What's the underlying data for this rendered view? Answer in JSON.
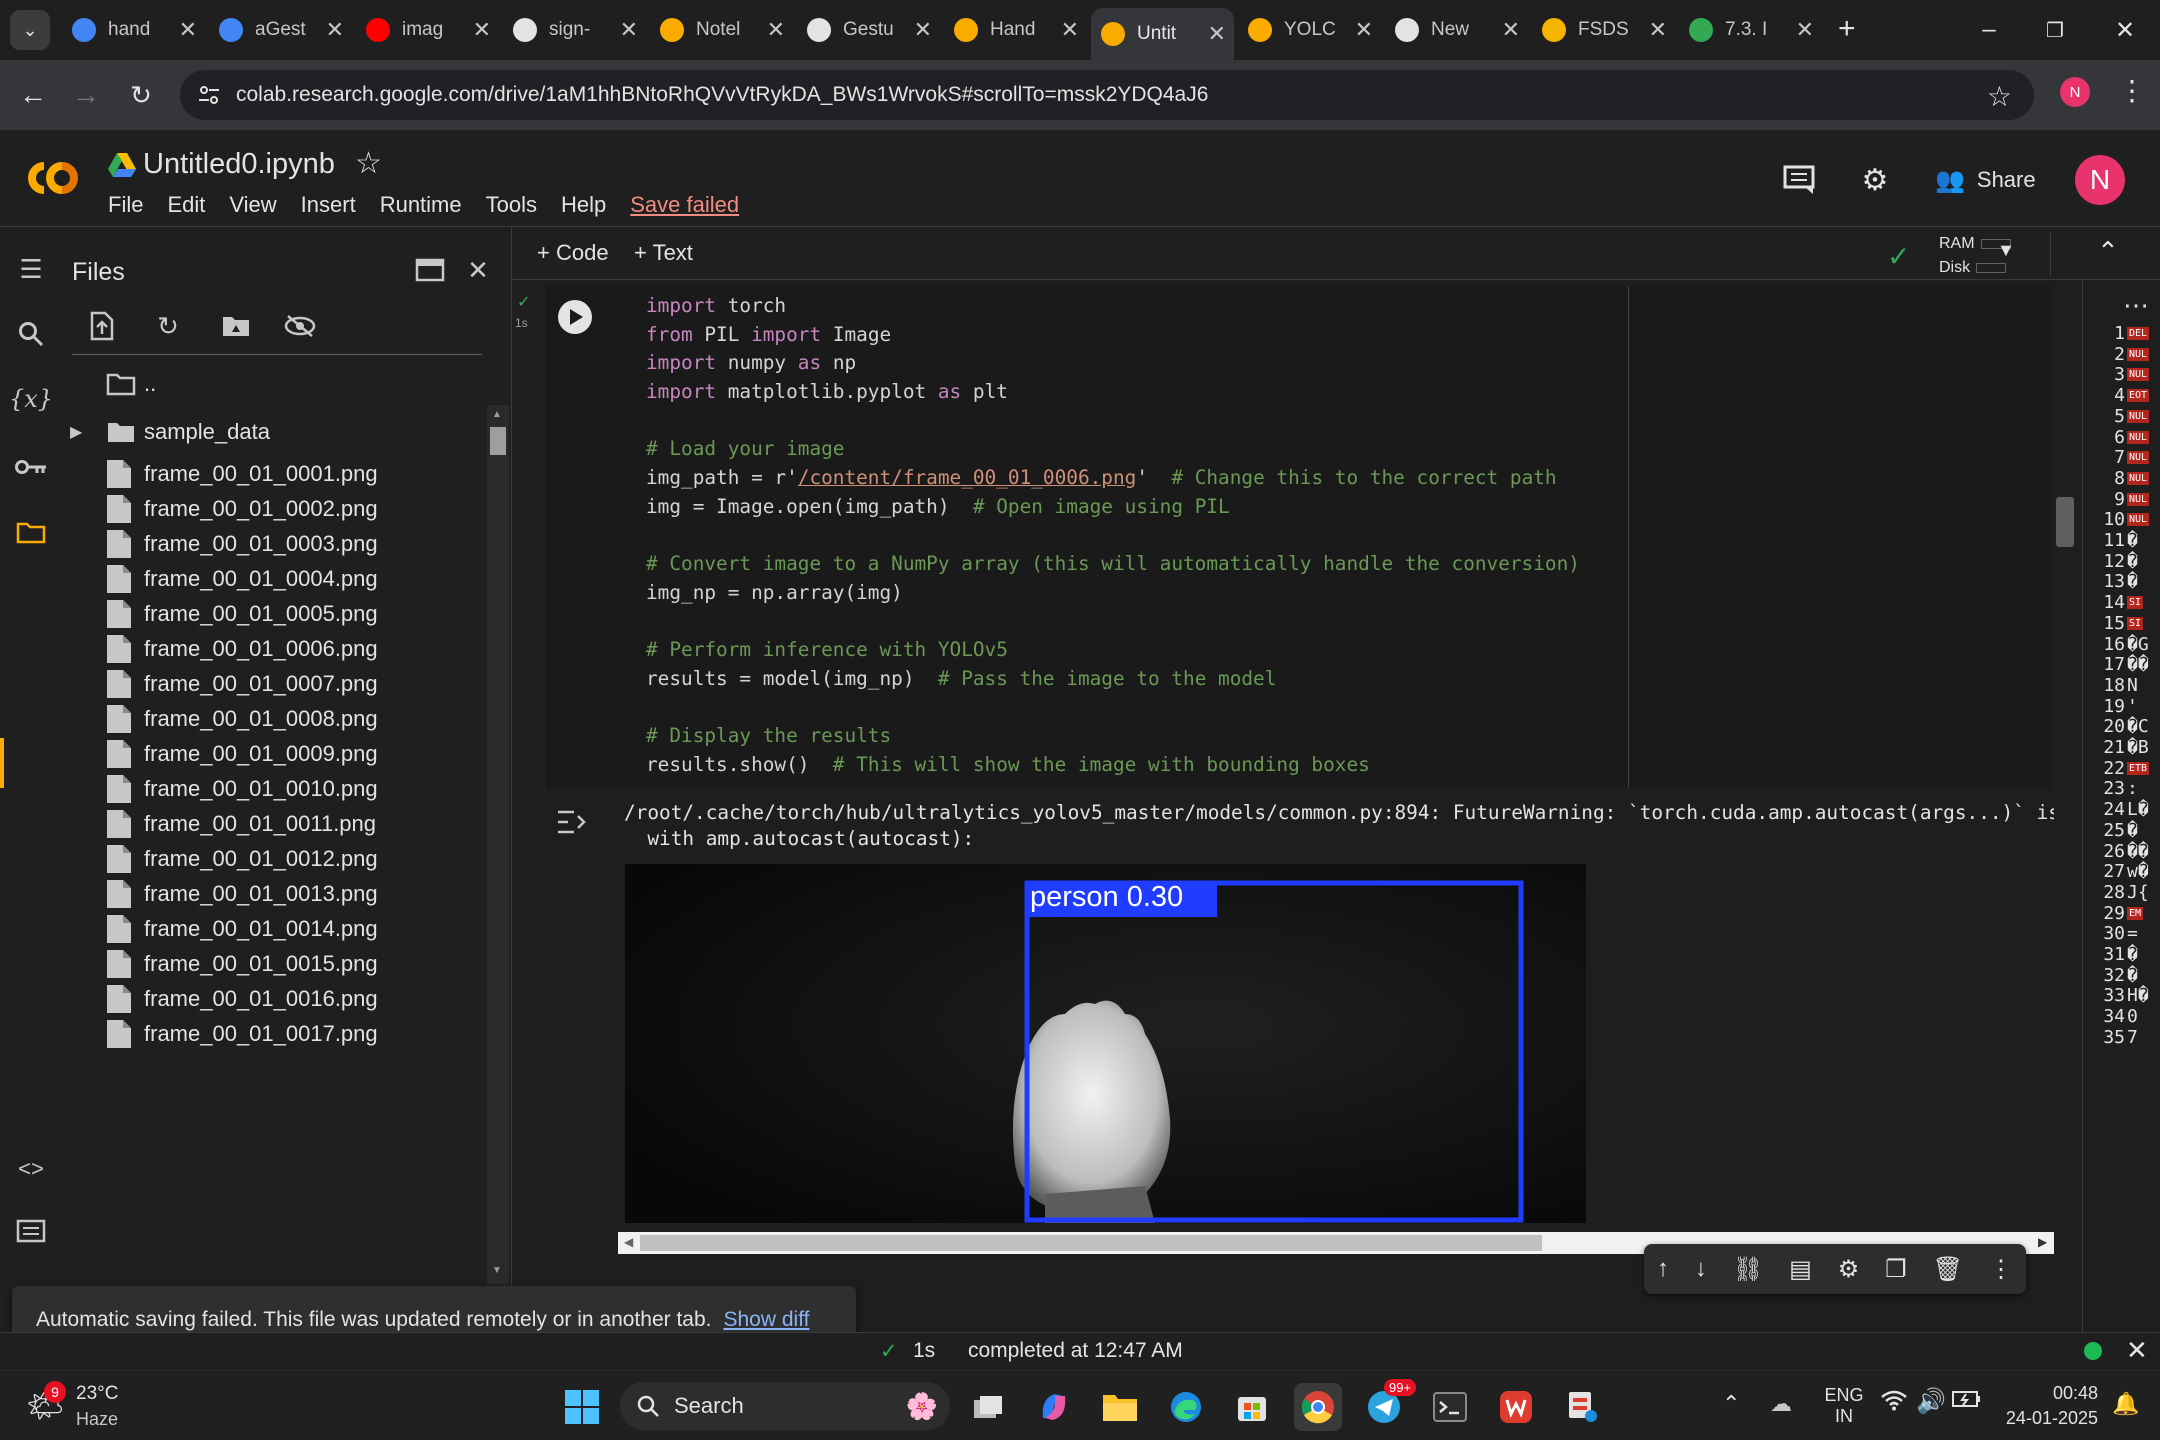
{
  "tabs": [
    {
      "label": "hand",
      "icon": "google-icon",
      "color": "#4285f4"
    },
    {
      "label": "aGest",
      "icon": "google-icon",
      "color": "#4285f4"
    },
    {
      "label": "imag",
      "icon": "youtube-icon",
      "color": "#ff0000"
    },
    {
      "label": "sign-",
      "icon": "github-icon",
      "color": "#e3e3e3"
    },
    {
      "label": "Notel",
      "icon": "colab-icon",
      "color": "#f9ab00"
    },
    {
      "label": "Gestu",
      "icon": "github-icon",
      "color": "#e3e3e3"
    },
    {
      "label": "Hand",
      "icon": "colab-icon",
      "color": "#f9ab00"
    },
    {
      "label": "Untit",
      "icon": "colab-icon",
      "color": "#f9ab00",
      "active": true
    },
    {
      "label": "YOLC",
      "icon": "colab-icon",
      "color": "#f9ab00"
    },
    {
      "label": "New",
      "icon": "chrome-icon",
      "color": "#e3e3e3"
    },
    {
      "label": "FSDS",
      "icon": "sheets-icon",
      "color": "#f4b400"
    },
    {
      "label": "7.3. I",
      "icon": "drive-icon",
      "color": "#34a853"
    }
  ],
  "address": {
    "url": "colab.research.google.com/drive/1aM1hhBNtoRhQVvVtRykDA_BWs1WrvokS#scrollTo=mssk2YDQ4aJ6",
    "profile_initial": "N"
  },
  "colab": {
    "title": "Untitled0.ipynb",
    "menu": [
      "File",
      "Edit",
      "View",
      "Insert",
      "Runtime",
      "Tools",
      "Help"
    ],
    "save_status": "Save failed",
    "share_label": "Share",
    "avatar_initial": "N"
  },
  "files_panel": {
    "title": "Files",
    "parent_dir": "..",
    "folder": "sample_data",
    "files": [
      "frame_00_01_0001.png",
      "frame_00_01_0002.png",
      "frame_00_01_0003.png",
      "frame_00_01_0004.png",
      "frame_00_01_0005.png",
      "frame_00_01_0006.png",
      "frame_00_01_0007.png",
      "frame_00_01_0008.png",
      "frame_00_01_0009.png",
      "frame_00_01_0010.png",
      "frame_00_01_0011.png",
      "frame_00_01_0012.png",
      "frame_00_01_0013.png",
      "frame_00_01_0014.png",
      "frame_00_01_0015.png",
      "frame_00_01_0016.png",
      "frame_00_01_0017.png"
    ]
  },
  "notebook_toolbar": {
    "add_code": "+ Code",
    "add_text": "+ Text",
    "ram_label": "RAM",
    "disk_label": "Disk"
  },
  "cell": {
    "exec_time": "1s",
    "code_lines": [
      [
        {
          "t": "import",
          "c": "kw"
        },
        {
          "t": " torch"
        }
      ],
      [
        {
          "t": "from",
          "c": "kw"
        },
        {
          "t": " PIL "
        },
        {
          "t": "import",
          "c": "kw"
        },
        {
          "t": " Image"
        }
      ],
      [
        {
          "t": "import",
          "c": "kw"
        },
        {
          "t": " numpy "
        },
        {
          "t": "as",
          "c": "kw"
        },
        {
          "t": " np"
        }
      ],
      [
        {
          "t": "import",
          "c": "kw"
        },
        {
          "t": " matplotlib.pyplot "
        },
        {
          "t": "as",
          "c": "kw"
        },
        {
          "t": " plt"
        }
      ],
      [
        {
          "t": ""
        }
      ],
      [
        {
          "t": "# Load your image",
          "c": "cm"
        }
      ],
      [
        {
          "t": "img_path = r'"
        },
        {
          "t": "/content/frame_00_01_0006.png",
          "c": "st"
        },
        {
          "t": "'  "
        },
        {
          "t": "# Change this to the correct path",
          "c": "cm"
        }
      ],
      [
        {
          "t": "img = Image.open(img_path)  "
        },
        {
          "t": "# Open image using PIL",
          "c": "cm"
        }
      ],
      [
        {
          "t": ""
        }
      ],
      [
        {
          "t": "# Convert image to a NumPy array (this will automatically handle the conversion)",
          "c": "cm"
        }
      ],
      [
        {
          "t": "img_np = np.array(img)"
        }
      ],
      [
        {
          "t": ""
        }
      ],
      [
        {
          "t": "# Perform inference with YOLOv5",
          "c": "cm"
        }
      ],
      [
        {
          "t": "results = model(img_np)  "
        },
        {
          "t": "# Pass the image to the model",
          "c": "cm"
        }
      ],
      [
        {
          "t": ""
        }
      ],
      [
        {
          "t": "# Display the results",
          "c": "cm"
        }
      ],
      [
        {
          "t": "results.show()  "
        },
        {
          "t": "# This will show the image with bounding boxes",
          "c": "cm"
        }
      ]
    ],
    "output_lines": [
      "/root/.cache/torch/hub/ultralytics_yolov5_master/models/common.py:894: FutureWarning: `torch.cuda.amp.autocast(args...)` is",
      "  with amp.autocast(autocast):"
    ],
    "detection_label": "person 0.30"
  },
  "hex_panel": {
    "rows": [
      {
        "n": "1",
        "ctl": "DEL",
        "g": ""
      },
      {
        "n": "2",
        "ctl": "NUL",
        "g": ""
      },
      {
        "n": "3",
        "ctl": "NUL",
        "g": ""
      },
      {
        "n": "4",
        "ctl": "EOT",
        "g": ""
      },
      {
        "n": "5",
        "ctl": "NUL",
        "g": ""
      },
      {
        "n": "6",
        "ctl": "NUL",
        "g": ""
      },
      {
        "n": "7",
        "ctl": "NUL",
        "g": ""
      },
      {
        "n": "8",
        "ctl": "NUL",
        "g": ""
      },
      {
        "n": "9",
        "ctl": "NUL",
        "g": ""
      },
      {
        "n": "10",
        "ctl": "NUL",
        "g": ""
      },
      {
        "n": "11",
        "ctl": "",
        "g": "�"
      },
      {
        "n": "12",
        "ctl": "",
        "g": "�"
      },
      {
        "n": "13",
        "ctl": "",
        "g": "�"
      },
      {
        "n": "14",
        "ctl": "SI",
        "g": ""
      },
      {
        "n": "15",
        "ctl": "SI",
        "g": ""
      },
      {
        "n": "16",
        "ctl": "",
        "g": "�G"
      },
      {
        "n": "17",
        "ctl": "",
        "g": "��"
      },
      {
        "n": "18",
        "ctl": "",
        "g": "N"
      },
      {
        "n": "19",
        "ctl": "",
        "g": "'"
      },
      {
        "n": "20",
        "ctl": "",
        "g": "�C"
      },
      {
        "n": "21",
        "ctl": "",
        "g": "�B"
      },
      {
        "n": "22",
        "ctl": "ETB",
        "g": ""
      },
      {
        "n": "23",
        "ctl": "",
        "g": ":"
      },
      {
        "n": "24",
        "ctl": "",
        "g": "L�"
      },
      {
        "n": "25",
        "ctl": "",
        "g": "�"
      },
      {
        "n": "26",
        "ctl": "",
        "g": "��"
      },
      {
        "n": "27",
        "ctl": "",
        "g": "w�"
      },
      {
        "n": "28",
        "ctl": "",
        "g": "J{"
      },
      {
        "n": "29",
        "ctl": "EM",
        "g": ""
      },
      {
        "n": "30",
        "ctl": "",
        "g": "="
      },
      {
        "n": "31",
        "ctl": "",
        "g": "�"
      },
      {
        "n": "32",
        "ctl": "",
        "g": "�"
      },
      {
        "n": "33",
        "ctl": "",
        "g": "H�"
      },
      {
        "n": "34",
        "ctl": "",
        "g": "0"
      },
      {
        "n": "35",
        "ctl": "",
        "g": "7"
      }
    ]
  },
  "toast": {
    "message": "Automatic saving failed. This file was updated remotely or in another tab.",
    "link": "Show diff"
  },
  "status": {
    "duration": "1s",
    "completed": "completed at 12:47 AM"
  },
  "taskbar": {
    "weather_temp": "23°C",
    "weather_desc": "Haze",
    "weather_badge": "9",
    "search_placeholder": "Search",
    "telegram_badge": "99+",
    "lang_top": "ENG",
    "lang_bottom": "IN",
    "time": "00:48",
    "date": "24-01-2025"
  }
}
